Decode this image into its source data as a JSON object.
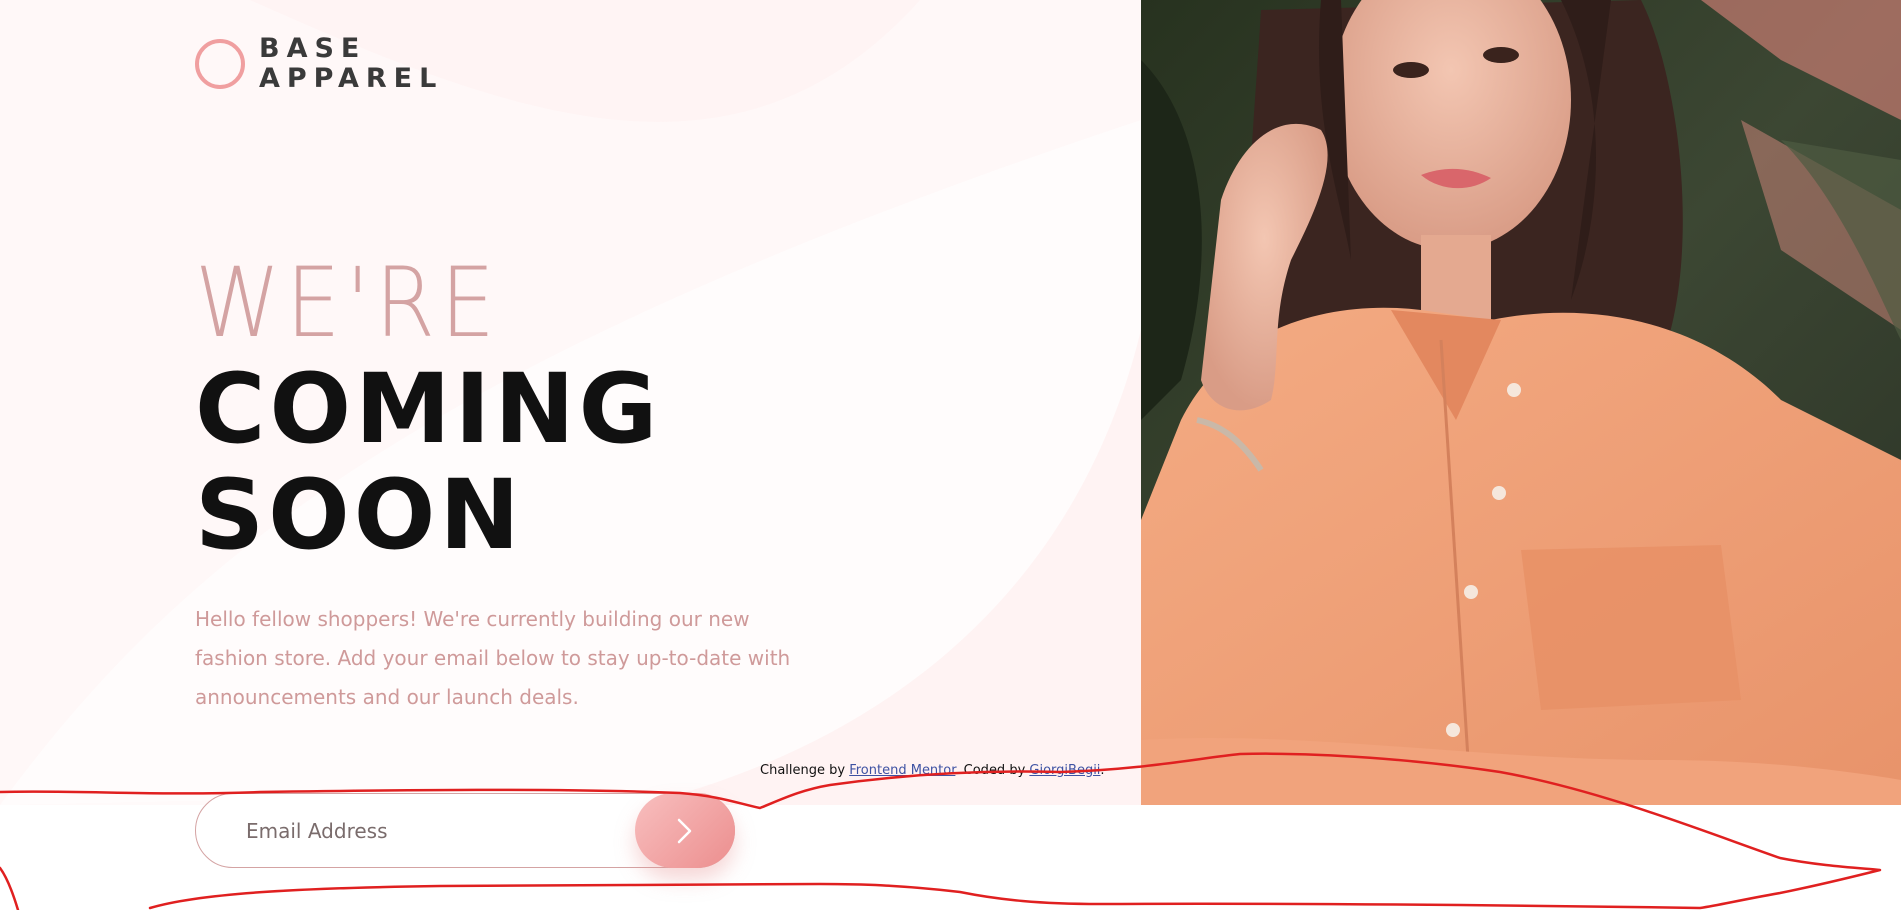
{
  "brand": {
    "line1": "BASE",
    "line2": "APPAREL",
    "accent_color": "#f09fa0",
    "icon": "circle-ring-icon"
  },
  "hero": {
    "line_light": "WE'RE",
    "line_bold_1": "COMING",
    "line_bold_2": "SOON",
    "light_color": "#d4a3a3",
    "bold_color": "#111111"
  },
  "intro": {
    "text": "Hello fellow shoppers! We're currently building our new fashion store. Add your email below to stay up-to-date with announcements and our launch deals."
  },
  "form": {
    "email_placeholder": "Email Address",
    "submit_icon": "chevron-right-icon",
    "button_gradient": [
      "#f8bfbf",
      "#ec8e8e"
    ]
  },
  "attribution": {
    "prefix": "Challenge by",
    "link1": "Frontend Mentor",
    "middle": ". Coded by",
    "link2": "GiorgiBegii",
    "suffix": "."
  },
  "image": {
    "subject": "woman-in-peach-shirt-photo",
    "shirt_color": "#f2a27a",
    "background_color": "#2f3a2c"
  },
  "annotation": {
    "stroke_color": "#e02020"
  }
}
